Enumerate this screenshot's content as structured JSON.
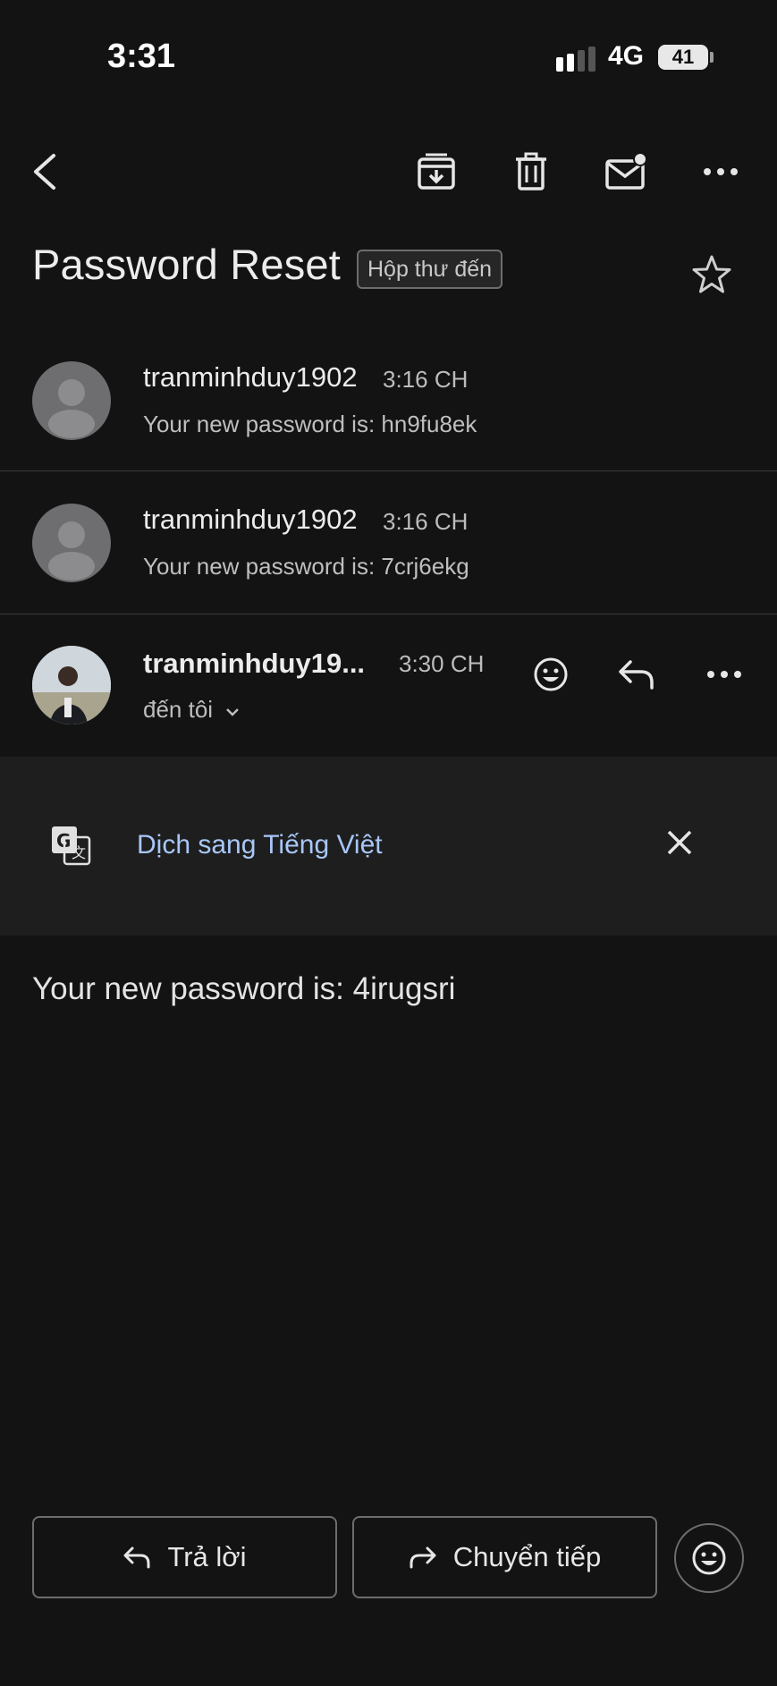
{
  "status_bar": {
    "time": "3:31",
    "network": "4G",
    "battery": "41"
  },
  "email": {
    "subject": "Password Reset",
    "label": "Hộp thư đến",
    "messages": [
      {
        "sender": "tranminhduy1902",
        "time": "3:16 CH",
        "snippet": "Your new password is: hn9fu8ek"
      },
      {
        "sender": "tranminhduy1902",
        "time": "3:16 CH",
        "snippet": "Your new password is: 7crj6ekg"
      }
    ],
    "open_message": {
      "sender": "tranminhduy19...",
      "time": "3:30 CH",
      "recipient": "đến tôi",
      "body": "Your new password is: 4irugsri"
    }
  },
  "translate": {
    "link": "Dịch sang Tiếng Việt"
  },
  "actions": {
    "reply": "Trả lời",
    "forward": "Chuyển tiếp"
  },
  "icons": {
    "back": "chevron-left-icon",
    "archive": "archive-icon",
    "delete": "trash-icon",
    "unread": "mark-unread-icon",
    "more": "more-horizontal-icon",
    "star": "star-icon",
    "translate": "translate-icon",
    "close": "close-icon",
    "emoji": "emoji-icon",
    "reply": "reply-icon",
    "forward": "forward-icon"
  },
  "colors": {
    "background": "#131313",
    "banner": "#1e1e1e",
    "link": "#a8c7fa"
  }
}
